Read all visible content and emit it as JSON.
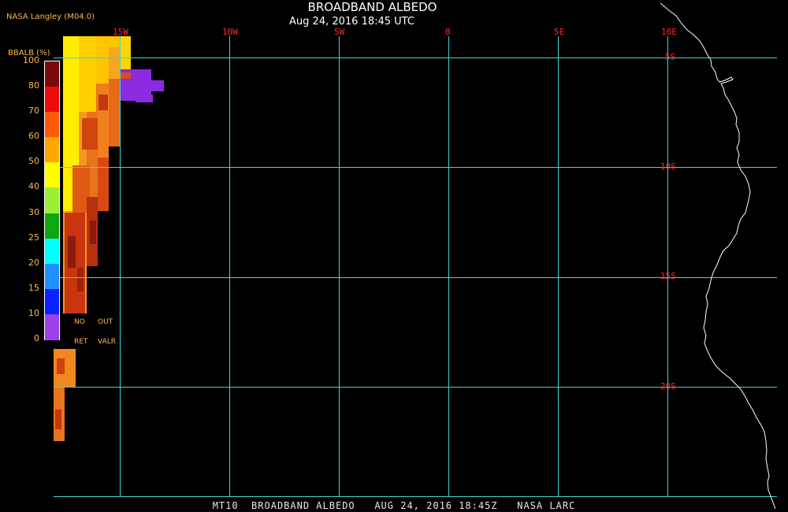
{
  "header": {
    "title": "BROADBAND ALBEDO",
    "subtitle": "Aug 24, 2016 18:45 UTC",
    "credit": "NASA Langley (M04.0)"
  },
  "footer": {
    "text": "MT10  BROADBAND ALBEDO   AUG 24, 2016 18:45Z   NASA LARC"
  },
  "map": {
    "lon_labels": [
      "15W",
      "10W",
      "5W",
      "0",
      "5E",
      "10E"
    ],
    "lat_labels": [
      "5S",
      "10S",
      "15S",
      "20S"
    ],
    "grid_color": "#3fd6d6",
    "label_color": "#ff2a2a",
    "coastline_color": "#ffffff"
  },
  "legend": {
    "title": "BBALB (%)",
    "ticks": [
      "100",
      "80",
      "70",
      "60",
      "50",
      "40",
      "30",
      "25",
      "20",
      "15",
      "10",
      "0"
    ],
    "colors": [
      "#7a0a0a",
      "#ee0b0b",
      "#ff5a0a",
      "#ffa500",
      "#ffff00",
      "#9aee33",
      "#0fa60f",
      "#00ffff",
      "#1e90ff",
      "#0a22ff",
      "#9b3fe6"
    ],
    "notes": {
      "no_ret_top": "NO",
      "no_ret_bottom": "RET",
      "out_valr_top": "OUT",
      "out_valr_bottom": "VALR"
    },
    "no_ret_color": "#000000",
    "out_valr_color": "#ffffff"
  },
  "data_colors": {
    "dark_red": "#8b1a0a",
    "red": "#d2280c",
    "orange": "#f07818",
    "light_orange": "#ffa500",
    "yellow": "#ffee00",
    "purple": "#8a2be2"
  }
}
